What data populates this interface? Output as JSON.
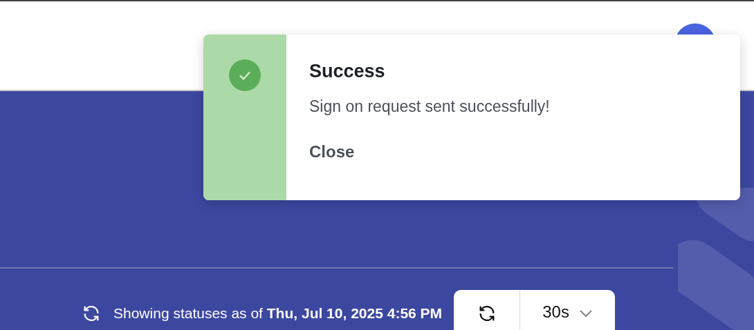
{
  "toast": {
    "title": "Success",
    "message": "Sign on request sent successfully!",
    "action": "Close"
  },
  "status": {
    "text": "Showing statuses as of **Thu, Jul 10, 2025 4:56 PM**"
  },
  "refresh_interval": {
    "value": "30s"
  }
}
